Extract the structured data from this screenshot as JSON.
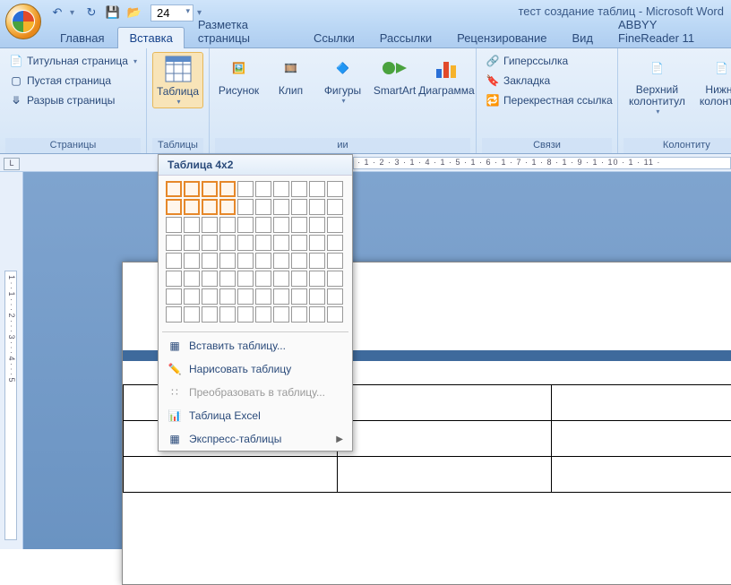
{
  "app": {
    "title": "тест создание таблиц - Microsoft Word"
  },
  "qat": {
    "zoom": "24"
  },
  "tabs": [
    "Главная",
    "Вставка",
    "Разметка страницы",
    "Ссылки",
    "Рассылки",
    "Рецензирование",
    "Вид",
    "ABBYY FineReader 11"
  ],
  "active_tab": 1,
  "ribbon": {
    "pages": {
      "label": "Страницы",
      "cover": "Титульная страница",
      "blank": "Пустая страница",
      "break": "Разрыв страницы"
    },
    "tables": {
      "label": "Таблицы",
      "button": "Таблица"
    },
    "illus": {
      "label": "ии",
      "picture": "Рисунок",
      "clip": "Клип",
      "shapes": "Фигуры",
      "smartart": "SmartArt",
      "chart": "Диаграмма"
    },
    "links": {
      "label": "Связи",
      "hyper": "Гиперссылка",
      "bookmark": "Закладка",
      "crossref": "Перекрестная ссылка"
    },
    "headers": {
      "label": "Колонтиту",
      "header": "Верхний колонтитул",
      "footer": "Нижни колонтит"
    }
  },
  "table_menu": {
    "header": "Таблица 4x2",
    "grid": {
      "cols": 10,
      "rows": 8,
      "sel_cols": 4,
      "sel_rows": 2
    },
    "insert": "Вставить таблицу...",
    "draw": "Нарисовать таблицу",
    "convert": "Преобразовать в таблицу...",
    "excel": "Таблица Excel",
    "quick": "Экспресс-таблицы"
  },
  "ruler": {
    "h": "· 1 · 2 · 3 · 1 · 4 · 1 · 5 · 1 · 6 · 1 · 7 · 1 · 8 · 1 · 9 · 1 · 10 · 1 · 11 ·",
    "v": "1 · · 1 · · · 2 · · · 3 · · · 4 · · · 5"
  },
  "doc": {
    "table_rows": 3,
    "table_cols": 3
  }
}
